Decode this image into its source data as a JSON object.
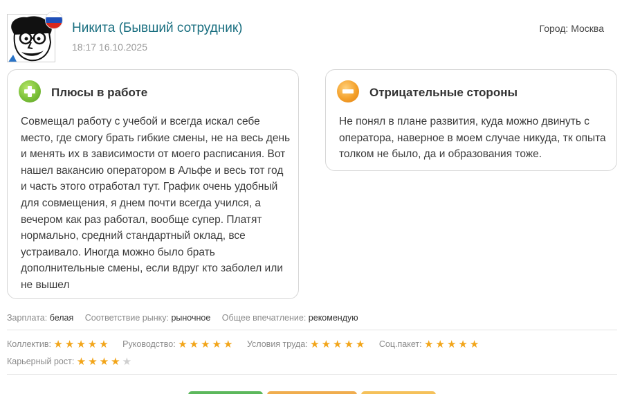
{
  "author": {
    "name": "Никита (Бывший сотрудник)",
    "datetime": "18:17 16.10.2025",
    "flag_colors": [
      "#ffffff",
      "#1f4fb8",
      "#d8281e"
    ]
  },
  "city": {
    "label": "Город:",
    "value": "Москва"
  },
  "pros": {
    "title": "Плюсы в работе",
    "icon": "plus-circle-icon",
    "text": "Совмещал работу с учебой и всегда искал себе место, где смогу брать гибкие смены, не на весь день и менять их в зависимости от моего расписания. Вот нашел вакансию оператором в Альфе и весь тот год и часть этого отработал тут. График очень удобный для совмещения, я днем почти всегда учился, а вечером как раз работал, вообще супер. Платят нормально, средний стандартный оклад, все устраивало. Иногда можно было брать дополнительные смены, если вдруг кто заболел или не вышел"
  },
  "cons": {
    "title": "Отрицательные стороны",
    "icon": "minus-circle-icon",
    "text": "Не понял в плане развития, куда можно двинуть с оператора, наверное в моем случае никуда, тк опыта толком не было, да и образования тоже."
  },
  "meta": [
    {
      "label": "Зарплата:",
      "value": "белая"
    },
    {
      "label": "Соответствие рынку:",
      "value": "рыночное"
    },
    {
      "label": "Общее впечатление:",
      "value": "рекомендую"
    }
  ],
  "ratings": [
    {
      "label": "Коллектив:",
      "stars": 5,
      "max": 5
    },
    {
      "label": "Руководство:",
      "stars": 5,
      "max": 5
    },
    {
      "label": "Условия труда:",
      "stars": 5,
      "max": 5
    },
    {
      "label": "Соц.пакет:",
      "stars": 5,
      "max": 5
    },
    {
      "label": "Карьерный рост:",
      "stars": 4,
      "max": 5
    }
  ],
  "colors": {
    "name_link": "#1a6f80",
    "star_on": "#f2a51a",
    "star_off": "#cfcfcf",
    "button_green": "#5cb85c",
    "button_orange": "#f0ad4e",
    "button_yellow": "#f5c15a"
  }
}
